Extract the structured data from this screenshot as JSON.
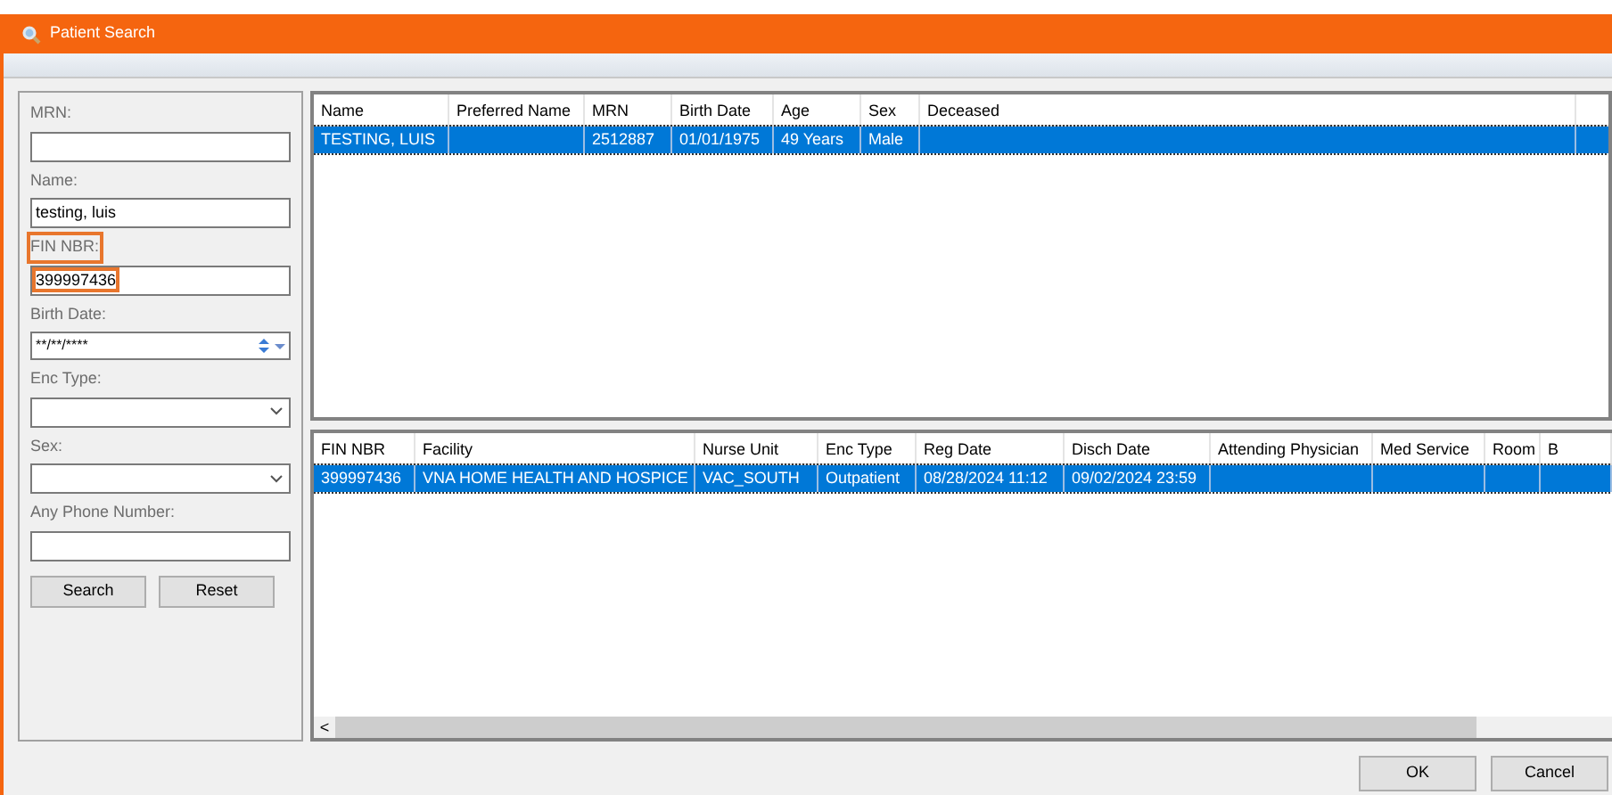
{
  "window": {
    "title": "Patient Search"
  },
  "search_form": {
    "fields": [
      {
        "kind": "text",
        "label": "MRN:",
        "highlighted": false
      },
      {
        "kind": "text",
        "label": "Name:",
        "value": "testing, luis",
        "highlighted": false
      },
      {
        "kind": "text",
        "label": "FIN NBR:",
        "value": "399997436",
        "highlighted": true
      },
      {
        "kind": "date",
        "label": "Birth Date:",
        "value": "**/**/****",
        "highlighted": false
      },
      {
        "kind": "dropdown",
        "label": "Enc Type:",
        "highlighted": false
      },
      {
        "kind": "dropdown",
        "label": "Sex:",
        "highlighted": false
      },
      {
        "kind": "text",
        "label": "Any Phone Number:",
        "highlighted": false
      }
    ],
    "buttons": [
      "Search",
      "Reset"
    ]
  },
  "patients_table": {
    "columns": [
      "Name",
      "Preferred Name",
      "MRN",
      "Birth Date",
      "Age",
      "Sex",
      "Deceased"
    ],
    "rows": [
      {
        "selected": true,
        "cells": [
          "TESTING, LUIS",
          "",
          "2512887",
          "01/01/1975",
          "49 Years",
          "Male",
          ""
        ]
      }
    ]
  },
  "encounters_table": {
    "columns": [
      "FIN NBR",
      "Facility",
      "Nurse Unit",
      "Enc Type",
      "Reg Date",
      "Disch Date",
      "Attending Physician",
      "Med Service",
      "Room",
      "B"
    ],
    "rows": [
      {
        "selected": true,
        "cells": [
          "399997436",
          "VNA HOME HEALTH AND HOSPICE",
          "VAC_SOUTH",
          "Outpatient",
          "08/28/2024 11:12",
          "09/02/2024 23:59",
          "",
          "",
          "",
          ""
        ]
      }
    ],
    "scroll_left": "<"
  },
  "dialog_buttons": [
    "OK",
    "Cancel"
  ]
}
